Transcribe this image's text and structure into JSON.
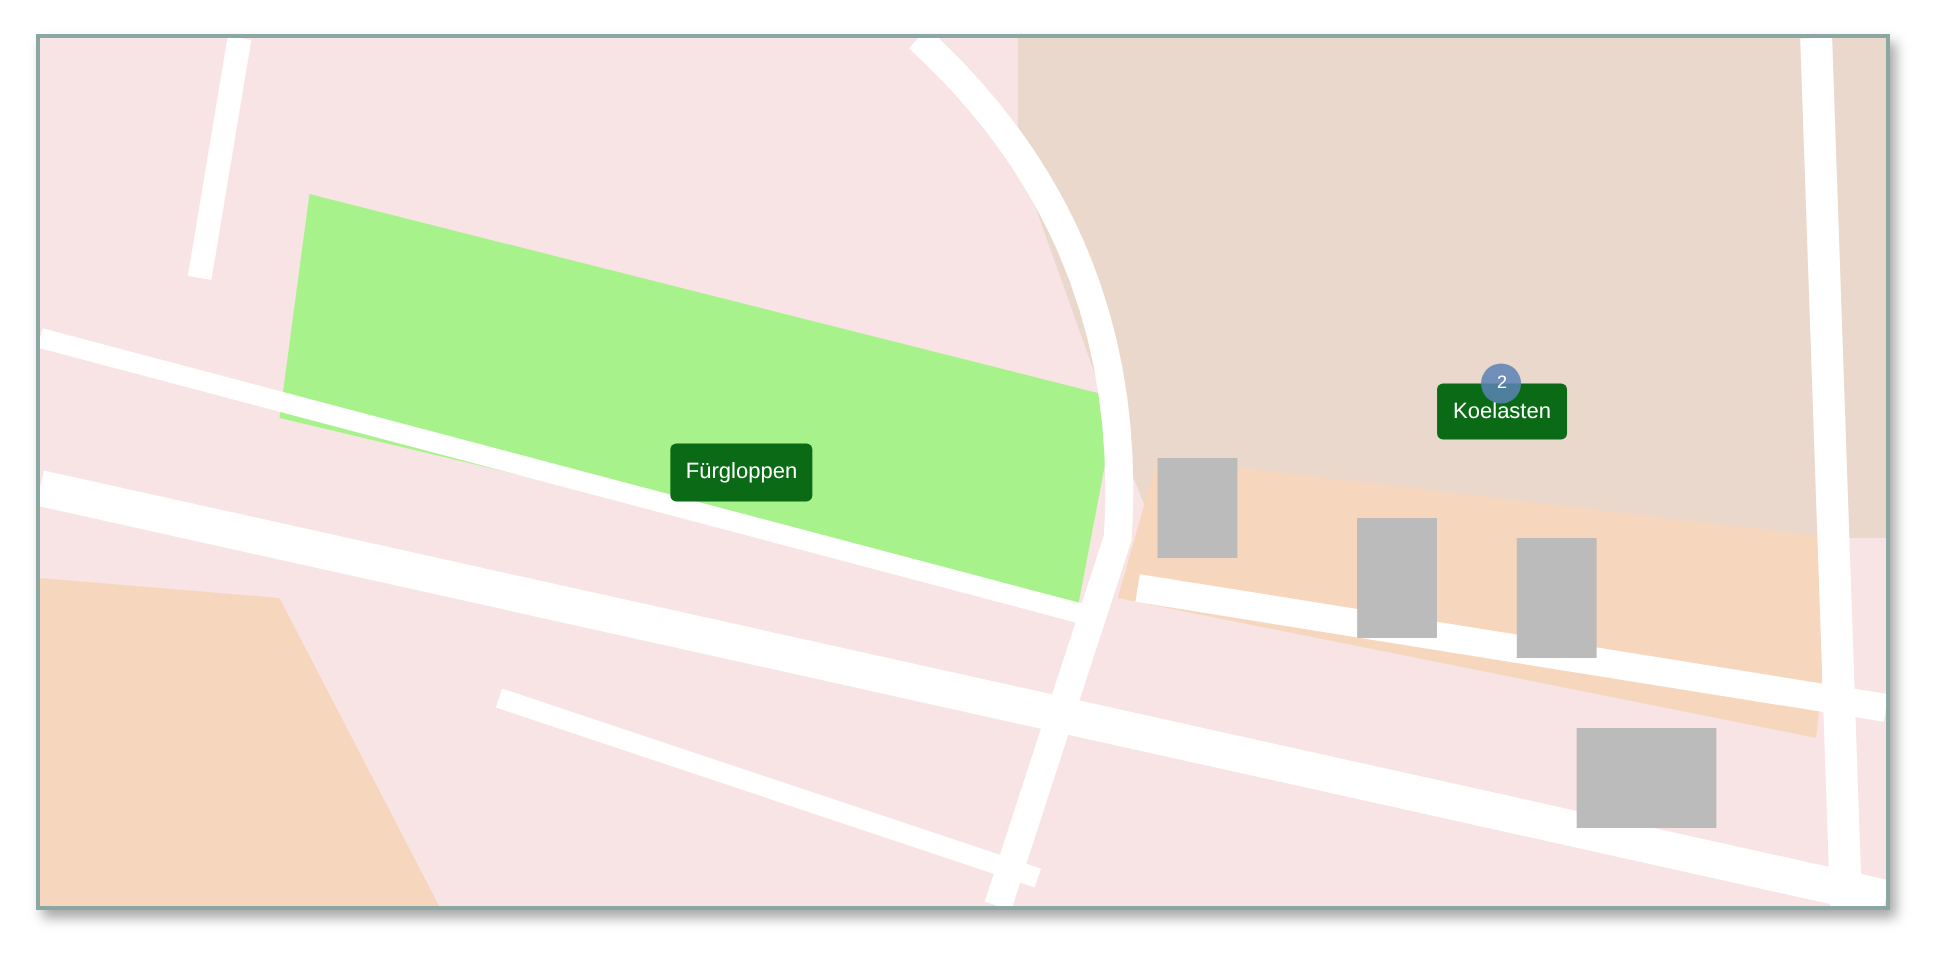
{
  "map": {
    "markers": [
      {
        "label": "Fürgloppen"
      },
      {
        "label": "Koelasten",
        "badge": "2"
      }
    ]
  }
}
